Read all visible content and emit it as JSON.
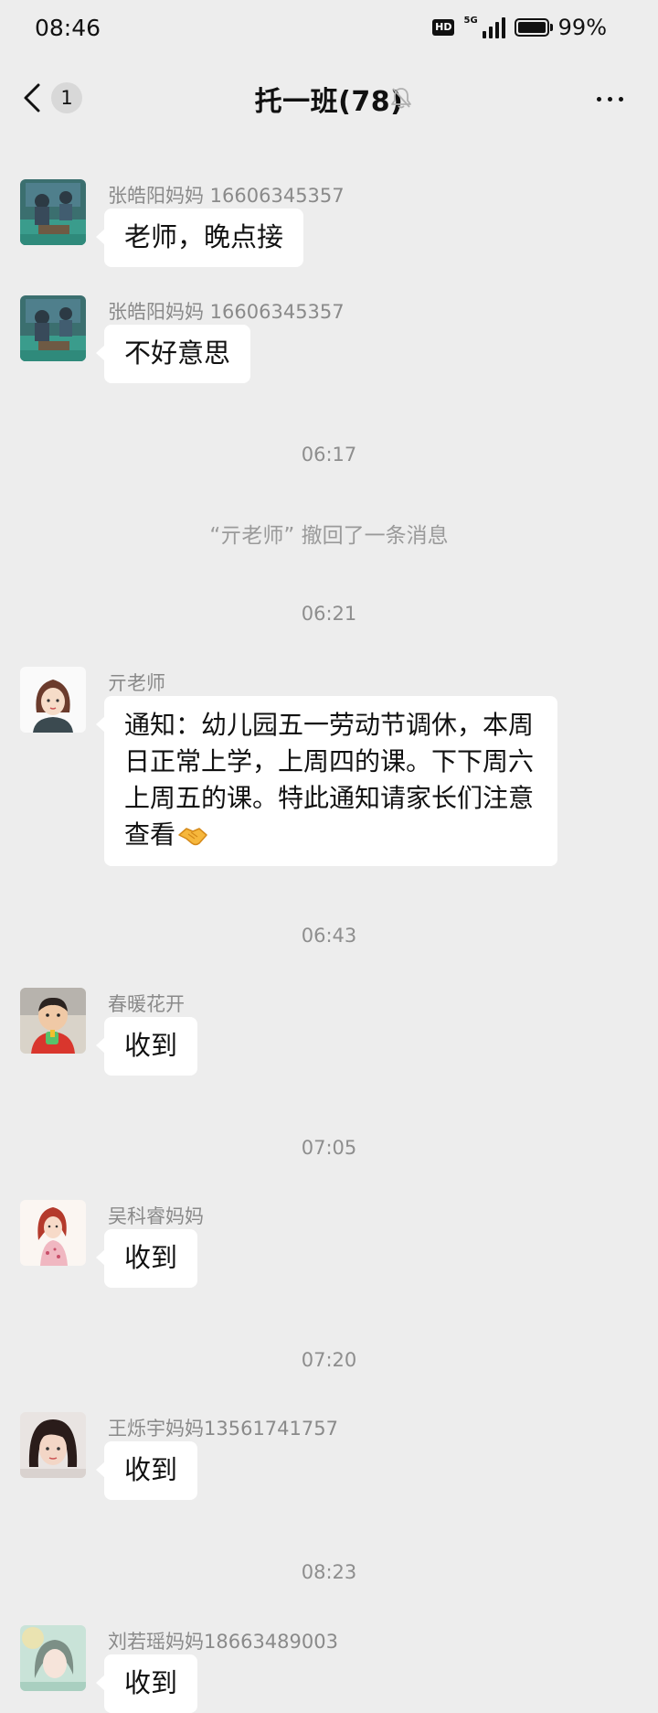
{
  "status_bar": {
    "time": "08:46",
    "hd_label": "HD",
    "network": "5G",
    "battery_text": "99%",
    "battery_level": 0.99
  },
  "nav": {
    "unread_count": "1",
    "title": "托一班(78)",
    "icons": [
      "back-arrow-icon",
      "mute-bell-icon",
      "more-icon"
    ]
  },
  "messages": [
    {
      "sender": "张皓阳妈妈 16606345357",
      "text": "老师，晚点接",
      "avatar": "classroom-photo"
    },
    {
      "sender": "张皓阳妈妈 16606345357",
      "text": "不好意思",
      "avatar": "classroom-photo"
    },
    {
      "sender": "亓老师",
      "text": "通知：幼儿园五一劳动节调休，本周日正常上学，上周四的课。下下周六上周五的课。特此通知请家长们注意查看",
      "emoji": "handshake-emoji",
      "avatar": "woman-cartoon"
    },
    {
      "sender": "春暖花开",
      "text": "收到",
      "avatar": "toddler-photo"
    },
    {
      "sender": "吴科睿妈妈",
      "text": "收到",
      "avatar": "girl-illustration"
    },
    {
      "sender": "王烁宇妈妈13561741757",
      "text": "收到",
      "avatar": "woman-selfie"
    },
    {
      "sender": "刘若瑶妈妈18663489003",
      "text": "收到",
      "avatar": "soft-portrait"
    }
  ],
  "timestamps": [
    "06:17",
    "06:21",
    "06:43",
    "07:05",
    "07:20",
    "08:23"
  ],
  "system_notice": "“亓老师” 撤回了一条消息",
  "colors": {
    "background": "#ededed",
    "bubble": "#ffffff",
    "meta_text": "#8e8e8e"
  }
}
